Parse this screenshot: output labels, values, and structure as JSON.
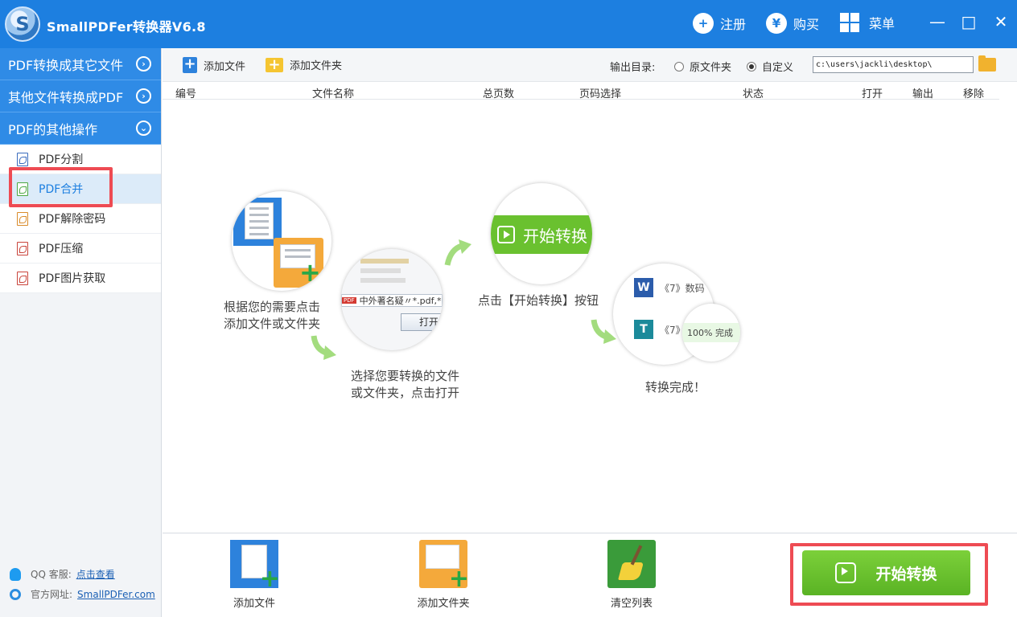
{
  "titlebar": {
    "app_title": "SmallPDFer转换器V6.8",
    "logo_letter": "S",
    "register": "注册",
    "buy": "购买",
    "buy_symbol": "¥",
    "menu": "菜单",
    "minimize": "—",
    "maximize": "□",
    "close": "✕"
  },
  "sidebar": {
    "categories": [
      {
        "label": "PDF转换成其它文件",
        "chevron": "›"
      },
      {
        "label": "其他文件转换成PDF",
        "chevron": "›"
      },
      {
        "label": "PDF的其他操作",
        "chevron": "⌄"
      }
    ],
    "items": [
      {
        "label": "PDF分割",
        "icon": "pdf-split-icon",
        "color": "#3a6bbd"
      },
      {
        "label": "PDF合并",
        "icon": "pdf-merge-icon",
        "color": "#4da843",
        "active": true
      },
      {
        "label": "PDF解除密码",
        "icon": "pdf-unlock-icon",
        "color": "#d98b2a"
      },
      {
        "label": "PDF压缩",
        "icon": "pdf-compress-icon",
        "color": "#c9443b"
      },
      {
        "label": "PDF图片获取",
        "icon": "pdf-image-icon",
        "color": "#c9443b"
      }
    ],
    "qq_label": "QQ 客服:",
    "qq_link": "点击查看",
    "site_label": "官方网址:",
    "site_link": "SmallPDFer.com"
  },
  "toolbar": {
    "add_file": "添加文件",
    "add_folder": "添加文件夹",
    "output_label": "输出目录:",
    "radio_original": "原文件夹",
    "radio_custom": "自定义",
    "output_path": "c:\\users\\jackli\\desktop\\"
  },
  "table": {
    "columns": [
      "编号",
      "文件名称",
      "总页数",
      "页码选择",
      "状态",
      "打开",
      "输出",
      "移除"
    ]
  },
  "guide": {
    "step1": [
      "根据您的需要点击",
      "添加文件或文件夹"
    ],
    "step2": [
      "选择您要转换的文件",
      "或文件夹，点击打开"
    ],
    "step2_file": "中外著名疑〃*.pdf,*.",
    "step2_open": "打开",
    "step3": "点击【开始转换】按钮",
    "step3_button": "开始转换",
    "step4": "转换完成！",
    "step4_row1": "《7》数码",
    "step4_row2": "《7》",
    "step4_progress": "100%  完成"
  },
  "bottombar": {
    "add_file": "添加文件",
    "add_folder": "添加文件夹",
    "clear_list": "清空列表",
    "start": "开始转换"
  }
}
